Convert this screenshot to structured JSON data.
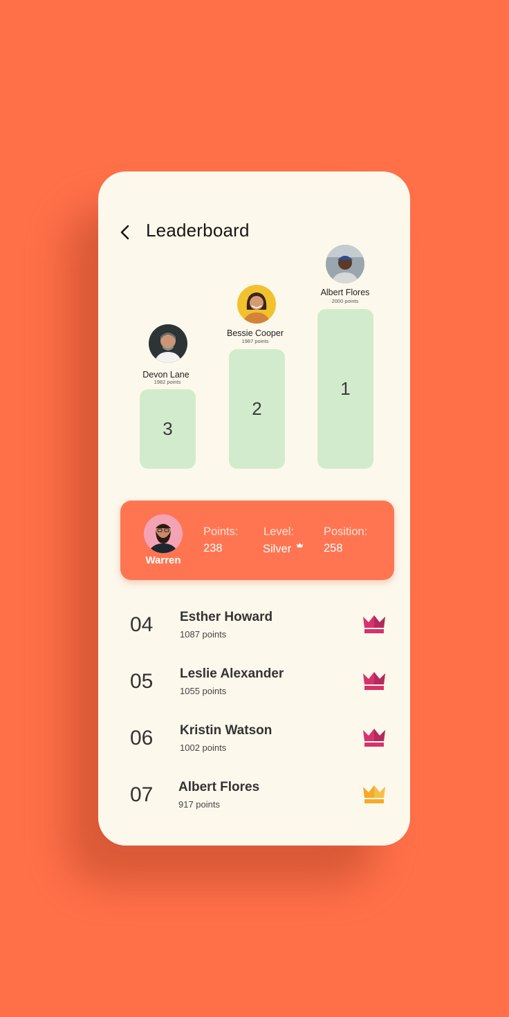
{
  "header": {
    "title": "Leaderboard"
  },
  "podium": [
    {
      "rank": "3",
      "name": "Devon Lane",
      "points": "1982 points"
    },
    {
      "rank": "2",
      "name": "Bessie Cooper",
      "points": "1987 points"
    },
    {
      "rank": "1",
      "name": "Albert Flores",
      "points": "2000 points"
    }
  ],
  "user": {
    "name": "Warren",
    "points_label": "Points:",
    "points_value": "238",
    "level_label": "Level:",
    "level_value": "Silver",
    "position_label": "Position:",
    "position_value": "258"
  },
  "list": [
    {
      "rank": "04",
      "name": "Esther Howard",
      "points": "1087 points",
      "crown": "pink-crown-icon"
    },
    {
      "rank": "05",
      "name": "Leslie Alexander",
      "points": "1055 points",
      "crown": "pink-crown-icon"
    },
    {
      "rank": "06",
      "name": "Kristin Watson",
      "points": "1002 points",
      "crown": "pink-crown-icon"
    },
    {
      "rank": "07",
      "name": "Albert Flores",
      "points": "917 points",
      "crown": "gold-crown-icon"
    }
  ],
  "colors": {
    "background": "#FF7049",
    "card": "#FDF8EC",
    "podium_bar": "#D3EBCD",
    "user_card": "#FF7552",
    "crown_pink": "#D6336C",
    "crown_gold": "#F7A928"
  }
}
